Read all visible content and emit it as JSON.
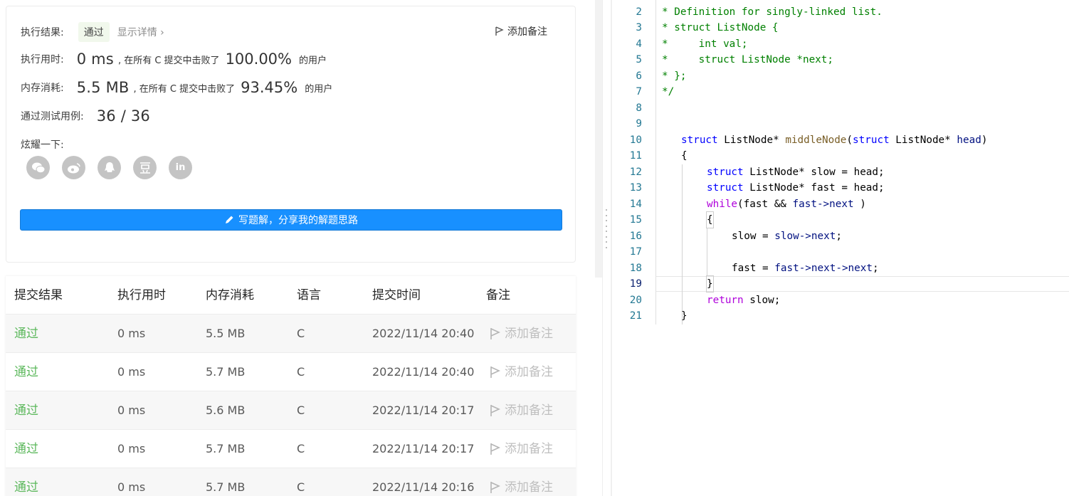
{
  "result": {
    "exec_result_label": "执行结果:",
    "status_badge": "通过",
    "show_detail": "显示详情",
    "add_note": "添加备注",
    "time_label": "执行用时:",
    "time_value": "0 ms",
    "time_beat_text": ", 在所有 C 提交中击败了",
    "time_pct": "100.00%",
    "users_text": "的用户",
    "mem_label": "内存消耗:",
    "mem_value": "5.5 MB",
    "mem_beat_text": ", 在所有 C 提交中击败了",
    "mem_pct": "93.45%",
    "tests_label": "通过测试用例:",
    "tests_value": "36 / 36",
    "share_label": "炫耀一下:",
    "share_icons": [
      "wechat-icon",
      "weibo-icon",
      "qq-icon",
      "douban-icon",
      "linkedin-icon"
    ],
    "linkedin_text": "in",
    "write_button": "写题解，分享我的解题思路",
    "accent": "#1890ff"
  },
  "table": {
    "headers": [
      "提交结果",
      "执行用时",
      "内存消耗",
      "语言",
      "提交时间",
      "备注"
    ],
    "rows": [
      {
        "status": "通过",
        "time": "0 ms",
        "memory": "5.5 MB",
        "lang": "C",
        "submitted": "2022/11/14 20:40",
        "note": "添加备注"
      },
      {
        "status": "通过",
        "time": "0 ms",
        "memory": "5.7 MB",
        "lang": "C",
        "submitted": "2022/11/14 20:40",
        "note": "添加备注"
      },
      {
        "status": "通过",
        "time": "0 ms",
        "memory": "5.6 MB",
        "lang": "C",
        "submitted": "2022/11/14 20:17",
        "note": "添加备注"
      },
      {
        "status": "通过",
        "time": "0 ms",
        "memory": "5.7 MB",
        "lang": "C",
        "submitted": "2022/11/14 20:17",
        "note": "添加备注"
      },
      {
        "status": "通过",
        "time": "0 ms",
        "memory": "5.7 MB",
        "lang": "C",
        "submitted": "2022/11/14 20:16",
        "note": "添加备注"
      }
    ],
    "status_color": "#5cb85c"
  },
  "editor": {
    "line_numbers": [
      "2",
      "3",
      "4",
      "5",
      "6",
      "7",
      "8",
      "9",
      "10",
      "11",
      "12",
      "13",
      "14",
      "15",
      "16",
      "17",
      "18",
      "19",
      "20",
      "21"
    ],
    "current_line": "19",
    "code": {
      "l2": "* Definition for singly-linked list.",
      "l3": "* struct ListNode {",
      "l4": "*     int val;",
      "l5": "*     struct ListNode *next;",
      "l6": "* };",
      "l7": "*/",
      "l10_kw": "struct",
      "l10_type": " ListNode* ",
      "l10_fn": "middleNode",
      "l10_p1": "(",
      "l10_kw2": "struct",
      "l10_p2": " ListNode* ",
      "l10_param": "head",
      "l10_p3": ")",
      "l11": "{",
      "l12_kw": "struct",
      "l12_rest": " ListNode* slow = head;",
      "l13_kw": "struct",
      "l13_rest": " ListNode* fast = head;",
      "l14_kw": "while",
      "l14_a": "(fast && ",
      "l14_b": "fast->next",
      "l14_c": " )",
      "l15": "{",
      "l16_a": "slow = ",
      "l16_b": "slow->next",
      "l16_c": ";",
      "l18_a": "fast = ",
      "l18_b": "fast->next->next",
      "l18_c": ";",
      "l19": "}",
      "l20_kw": "return",
      "l20_rest": " slow;",
      "l21": "}"
    }
  }
}
